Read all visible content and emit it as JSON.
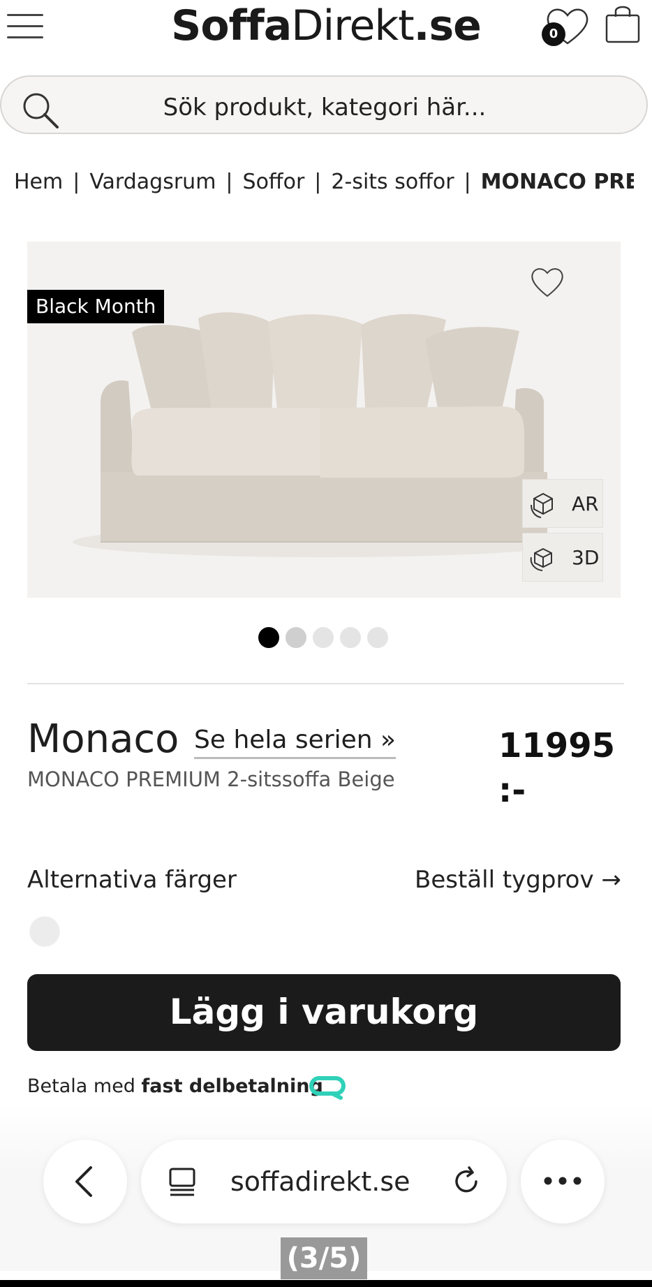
{
  "header": {
    "logo_part1": "Soffa",
    "logo_part2": "Direkt",
    "logo_part3": ".se",
    "wishlist_count": "0"
  },
  "search": {
    "placeholder": "Sök produkt, kategori här..."
  },
  "breadcrumb": {
    "items": [
      "Hem",
      "Vardagsrum",
      "Soffor",
      "2-sits soffor"
    ],
    "current": "MONACO PREMIU",
    "separator": "|"
  },
  "gallery": {
    "badge": "Black Month",
    "ar_label": "AR",
    "td_label": "3D",
    "slide_count": 5,
    "active_slide": 1
  },
  "product": {
    "series_name": "Monaco",
    "series_link": "Se hela serien »",
    "price": "11995 :-",
    "subtitle": "MONACO PREMIUM 2-sitssoffa Beige"
  },
  "options": {
    "alt_colors_label": "Alternativa färger",
    "order_sample_label": "Beställ tygprov",
    "order_sample_arrow": "→"
  },
  "cart": {
    "button_label": "Lägg i varukorg"
  },
  "payment": {
    "prefix": "Betala med",
    "bold": "fast delbetalning"
  },
  "browser": {
    "url": "soffadirekt.se",
    "counter": "(3/5)"
  },
  "colors": {
    "accent_dark": "#1b1b1b",
    "payment_logo": "#2fd1b8",
    "gallery_bg": "#f4f2f0"
  }
}
